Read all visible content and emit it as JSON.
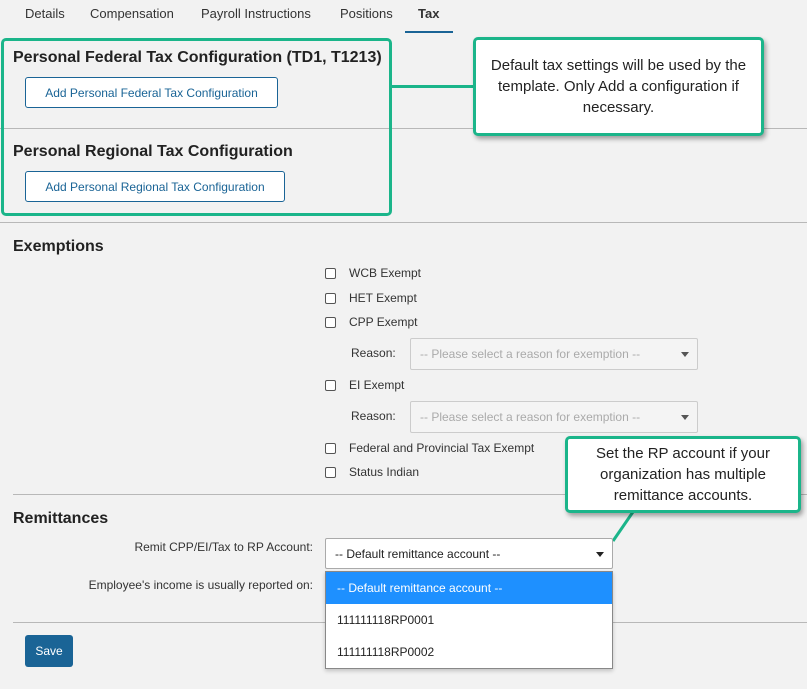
{
  "tabs": [
    {
      "label": "Details"
    },
    {
      "label": "Compensation"
    },
    {
      "label": "Payroll Instructions"
    },
    {
      "label": "Positions"
    },
    {
      "label": "Tax"
    }
  ],
  "federal": {
    "title": "Personal Federal Tax Configuration (TD1, T1213)",
    "button": "Add Personal Federal Tax Configuration"
  },
  "regional": {
    "title": "Personal Regional Tax Configuration",
    "button": "Add Personal Regional Tax Configuration"
  },
  "callout_default": "Default tax settings will be used by the template.  Only Add a configuration if necessary.",
  "exemptions": {
    "title": "Exemptions",
    "wcb": "WCB Exempt",
    "het": "HET Exempt",
    "cpp": "CPP Exempt",
    "cpp_reason_label": "Reason:",
    "cpp_reason_placeholder": "-- Please select a reason for exemption --",
    "ei": "EI Exempt",
    "ei_reason_label": "Reason:",
    "ei_reason_placeholder": "-- Please select a reason for exemption --",
    "fed_prov": "Federal and Provincial Tax Exempt",
    "status_indian": "Status Indian"
  },
  "callout_rp": "Set the RP account if your organization has multiple remittance accounts.",
  "remittances": {
    "title": "Remittances",
    "remit_label": "Remit CPP/EI/Tax to RP Account:",
    "remit_selected": "-- Default remittance account --",
    "income_label": "Employee's income is usually reported on:",
    "options": [
      "-- Default remittance account --",
      "111111118RP0001",
      "111111118RP0002"
    ]
  },
  "save_label": "Save",
  "colors": {
    "accent": "#1a6496",
    "highlight": "#1bb58a",
    "selected_option": "#1e90ff"
  }
}
